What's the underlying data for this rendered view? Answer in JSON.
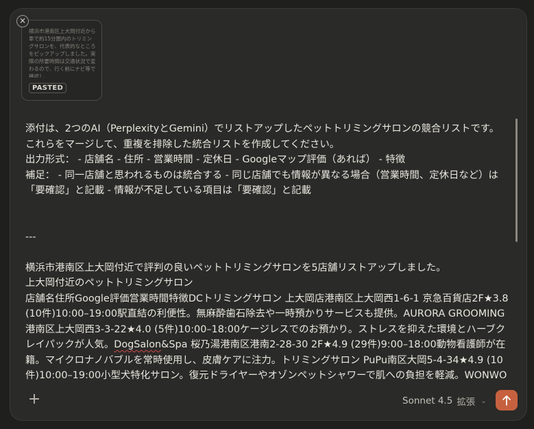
{
  "attachment": {
    "preview_text": "横浜市港南区上大岡付近から車で約15分圏内のトリミングサロンを、代表的なところをピックアップしました。実際の所要時間は交通状況で変わるので、行く前にナビ等で確認し…",
    "badge": "PASTED",
    "close_glyph": "×"
  },
  "editor": {
    "lines": [
      "添付は、2つのAI（PerplexityとGemini）でリストアップしたペットトリミングサロンの競合リストです。",
      "これらをマージして、重複を排除した統合リストを作成してください。",
      "出力形式： - 店舗名 - 住所 - 営業時間 - 定休日 - Googleマップ評価（あれば） - 特徴",
      "補足： - 同一店舗と思われるものは統合する - 同じ店舗でも情報が異なる場合（営業時間、定休日など）は「要確認」と記載 - 情報が不足している項目は「要確認」と記載"
    ],
    "separator": "---",
    "paste_intro": "横浜市港南区上大岡付近で評判の良いペットトリミングサロンを5店舗リストアップしました。",
    "paste_heading": "上大岡付近のペットトリミングサロン",
    "paste_body_a": "店舗名住所Google評価営業時間特徴DCトリミングサロン 上大岡店港南区上大岡西1-6-1 京急百貨店2F★3.8 (10件)10:00–19:00駅直結の利便性。無麻酔歯石除去や一時預かりサービスも提供。AURORA GROOMING港南区上大岡西3-3-22★4.0 (5件)10:00–18:00ケージレスでのお預かり。ストレスを抑えた環境とハーブクレイパックが人気。",
    "paste_body_misspelled": "DogSalon",
    "paste_body_b": "&Spa 桜乃湯港南区港南2-28-30 2F★4.9 (29件)9:00–18:00動物看護師が在籍。マイクロナノバブルを常時使用し、皮膚ケアに注力。トリミングサロン PuPu南区大岡5-4-34★4.9 (10件)10:00–19:00小型犬特化サロン。復元ドライヤーやオゾンペットシャワーで肌への負担を軽減。WONWON上大岡"
  },
  "toolbar": {
    "plus_glyph": "+",
    "model_name": "Sonnet 4.5",
    "mode_label": "拡張",
    "chevron_glyph": "⌄"
  },
  "colors": {
    "send_button": "#c6613f",
    "background": "#1f1f1e",
    "composer": "#2a2a28"
  }
}
